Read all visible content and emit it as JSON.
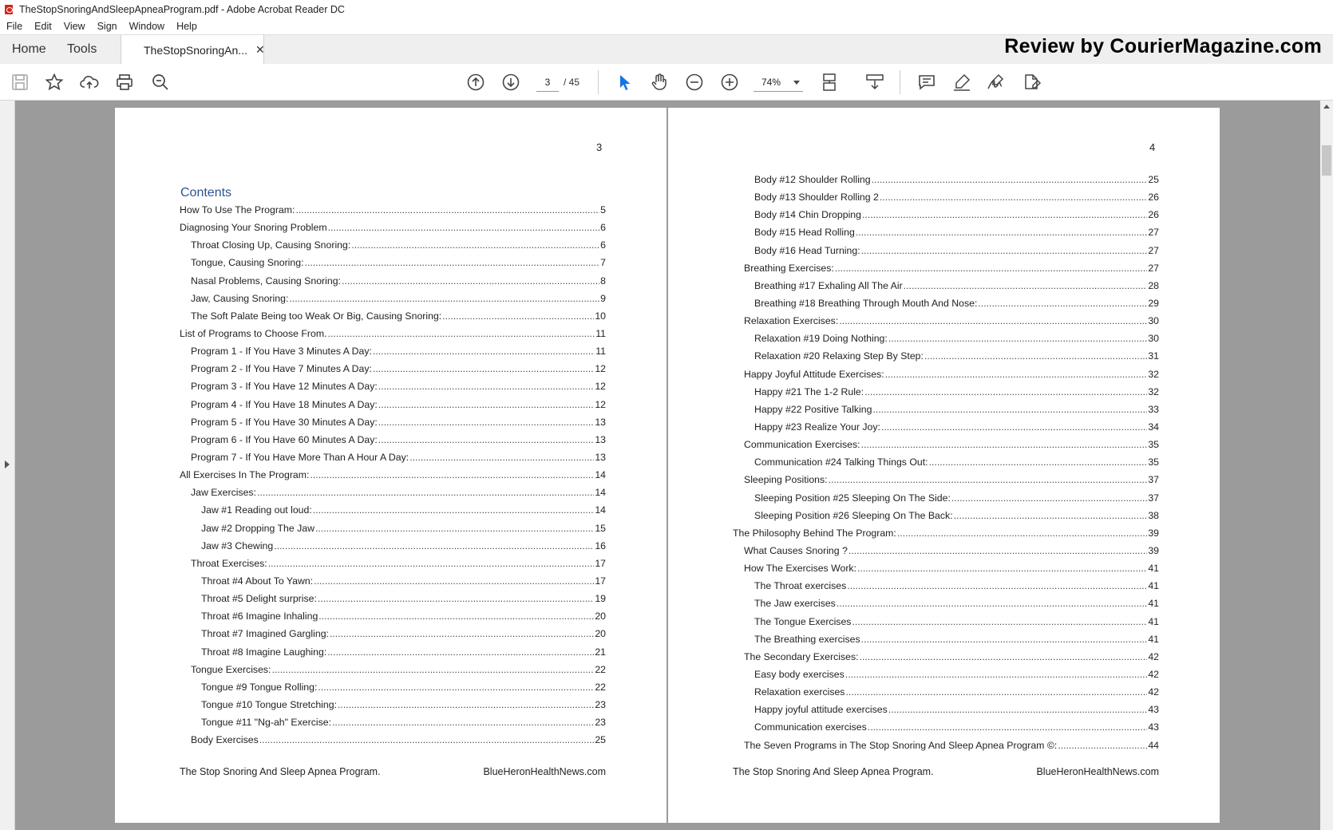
{
  "window": {
    "title": "TheStopSnoringAndSleepApneaProgram.pdf - Adobe Acrobat Reader DC"
  },
  "menu": [
    "File",
    "Edit",
    "View",
    "Sign",
    "Window",
    "Help"
  ],
  "tabs": {
    "home": "Home",
    "tools": "Tools",
    "document": "TheStopSnoringAn..."
  },
  "watermark": "Review by CourierMagazine.com",
  "toolbar": {
    "page_current": "3",
    "page_total": "/ 45",
    "zoom": "74%"
  },
  "pages": [
    {
      "number": "3",
      "heading": "Contents",
      "entries": [
        {
          "label": "How To Use The Program:",
          "page": "5",
          "level": 1
        },
        {
          "label": "Diagnosing Your Snoring Problem",
          "page": "6",
          "level": 1
        },
        {
          "label": "Throat Closing Up, Causing Snoring:",
          "page": "6",
          "level": 2
        },
        {
          "label": "Tongue, Causing Snoring:",
          "page": "7",
          "level": 2
        },
        {
          "label": "Nasal Problems, Causing Snoring:",
          "page": "8",
          "level": 2
        },
        {
          "label": "Jaw, Causing Snoring:",
          "page": "9",
          "level": 2
        },
        {
          "label": "The Soft Palate Being too Weak Or Big, Causing Snoring:",
          "page": "10",
          "level": 2
        },
        {
          "label": "List of Programs to Choose From.",
          "page": "11",
          "level": 1
        },
        {
          "label": "Program 1 - If You Have 3 Minutes A Day:",
          "page": "11",
          "level": 2
        },
        {
          "label": "Program 2 - If You Have 7 Minutes A Day:",
          "page": "12",
          "level": 2
        },
        {
          "label": "Program 3 - If You Have 12 Minutes A Day:",
          "page": "12",
          "level": 2
        },
        {
          "label": "Program 4 - If You Have 18 Minutes A Day:",
          "page": "12",
          "level": 2
        },
        {
          "label": "Program 5 - If You Have 30 Minutes A Day:",
          "page": "13",
          "level": 2
        },
        {
          "label": "Program 6 - If You Have 60 Minutes A Day:",
          "page": "13",
          "level": 2
        },
        {
          "label": "Program 7 - If You Have More Than A Hour A Day:",
          "page": "13",
          "level": 2
        },
        {
          "label": "All Exercises In The Program:",
          "page": "14",
          "level": 1
        },
        {
          "label": "Jaw Exercises:",
          "page": "14",
          "level": 2
        },
        {
          "label": "Jaw #1 Reading out loud:",
          "page": "14",
          "level": 3
        },
        {
          "label": "Jaw #2 Dropping The Jaw",
          "page": "15",
          "level": 3
        },
        {
          "label": "Jaw #3 Chewing",
          "page": "16",
          "level": 3
        },
        {
          "label": "Throat Exercises:",
          "page": "17",
          "level": 2
        },
        {
          "label": "Throat #4 About To Yawn:",
          "page": "17",
          "level": 3
        },
        {
          "label": "Throat #5 Delight surprise:",
          "page": "19",
          "level": 3
        },
        {
          "label": "Throat #6 Imagine Inhaling",
          "page": "20",
          "level": 3
        },
        {
          "label": "Throat #7 Imagined Gargling:",
          "page": "20",
          "level": 3
        },
        {
          "label": "Throat #8 Imagine Laughing:",
          "page": "21",
          "level": 3
        },
        {
          "label": "Tongue Exercises:",
          "page": "22",
          "level": 2
        },
        {
          "label": "Tongue #9 Tongue Rolling:",
          "page": "22",
          "level": 3
        },
        {
          "label": "Tongue #10 Tongue Stretching:",
          "page": "23",
          "level": 3
        },
        {
          "label": "Tongue #11 \"Ng-ah\" Exercise:",
          "page": "23",
          "level": 3
        },
        {
          "label": "Body Exercises",
          "page": "25",
          "level": 2
        }
      ],
      "footer_left": "The Stop Snoring And Sleep Apnea Program.",
      "footer_right": "BlueHeronHealthNews.com"
    },
    {
      "number": "4",
      "entries": [
        {
          "label": "Body #12 Shoulder Rolling",
          "page": "25",
          "level": 3
        },
        {
          "label": "Body #13 Shoulder Rolling 2",
          "page": "26",
          "level": 3
        },
        {
          "label": "Body #14 Chin Dropping",
          "page": "26",
          "level": 3
        },
        {
          "label": "Body #15 Head Rolling",
          "page": "27",
          "level": 3
        },
        {
          "label": "Body #16 Head Turning:",
          "page": "27",
          "level": 3
        },
        {
          "label": "Breathing Exercises:",
          "page": "27",
          "level": 2
        },
        {
          "label": "Breathing #17 Exhaling All The Air",
          "page": "28",
          "level": 3
        },
        {
          "label": "Breathing #18 Breathing Through Mouth And Nose:",
          "page": "29",
          "level": 3
        },
        {
          "label": "Relaxation Exercises:",
          "page": "30",
          "level": 2
        },
        {
          "label": "Relaxation #19 Doing Nothing:",
          "page": "30",
          "level": 3
        },
        {
          "label": "Relaxation #20 Relaxing Step By Step:",
          "page": "31",
          "level": 3
        },
        {
          "label": "Happy Joyful Attitude Exercises:",
          "page": "32",
          "level": 2
        },
        {
          "label": "Happy #21 The 1-2 Rule:",
          "page": "32",
          "level": 3
        },
        {
          "label": "Happy #22 Positive Talking",
          "page": "33",
          "level": 3
        },
        {
          "label": "Happy #23 Realize Your Joy:",
          "page": "34",
          "level": 3
        },
        {
          "label": "Communication Exercises:",
          "page": "35",
          "level": 2
        },
        {
          "label": "Communication #24 Talking Things Out:",
          "page": "35",
          "level": 3
        },
        {
          "label": "Sleeping Positions:",
          "page": "37",
          "level": 2
        },
        {
          "label": "Sleeping Position #25 Sleeping On The Side:",
          "page": "37",
          "level": 3
        },
        {
          "label": "Sleeping Position #26 Sleeping On The Back:",
          "page": "38",
          "level": 3
        },
        {
          "label": "The Philosophy Behind The Program:",
          "page": "39",
          "level": 1
        },
        {
          "label": "What Causes Snoring ?",
          "page": "39",
          "level": 2
        },
        {
          "label": "How The Exercises Work:",
          "page": "41",
          "level": 2
        },
        {
          "label": "The Throat exercises",
          "page": "41",
          "level": 3
        },
        {
          "label": "The Jaw exercises",
          "page": "41",
          "level": 3
        },
        {
          "label": "The Tongue Exercises",
          "page": "41",
          "level": 3
        },
        {
          "label": "The Breathing exercises",
          "page": "41",
          "level": 3
        },
        {
          "label": "The Secondary Exercises:",
          "page": "42",
          "level": 2
        },
        {
          "label": "Easy body exercises",
          "page": "42",
          "level": 3
        },
        {
          "label": "Relaxation exercises",
          "page": "42",
          "level": 3
        },
        {
          "label": "Happy joyful attitude exercises",
          "page": "43",
          "level": 3
        },
        {
          "label": "Communication exercises",
          "page": "43",
          "level": 3
        },
        {
          "label": "The Seven Programs in The Stop Snoring And Sleep Apnea Program ©:",
          "page": "44",
          "level": 2
        }
      ],
      "footer_left": "The Stop Snoring And Sleep Apnea Program.",
      "footer_right": "BlueHeronHealthNews.com"
    }
  ],
  "icons": {
    "save": "save-icon",
    "bookmark": "star-icon",
    "upload": "cloud-upload-icon",
    "print": "printer-icon",
    "find": "magnifier-icon",
    "prev": "arrow-up-circle-icon",
    "next": "arrow-down-circle-icon",
    "select": "pointer-icon",
    "hand": "hand-icon",
    "zoom_out": "zoom-out-icon",
    "zoom_in": "zoom-in-icon",
    "fit": "fit-page-icon",
    "scroll": "scroll-mode-icon",
    "comment": "comment-icon",
    "highlight": "highlighter-icon",
    "sign": "sign-icon",
    "fill": "fill-sign-icon"
  },
  "colors": {
    "accent_blue": "#2e5395",
    "tool_blue": "#1473e6",
    "viewer_bg": "#9b9b9b",
    "pdf_red": "#d4241c"
  }
}
